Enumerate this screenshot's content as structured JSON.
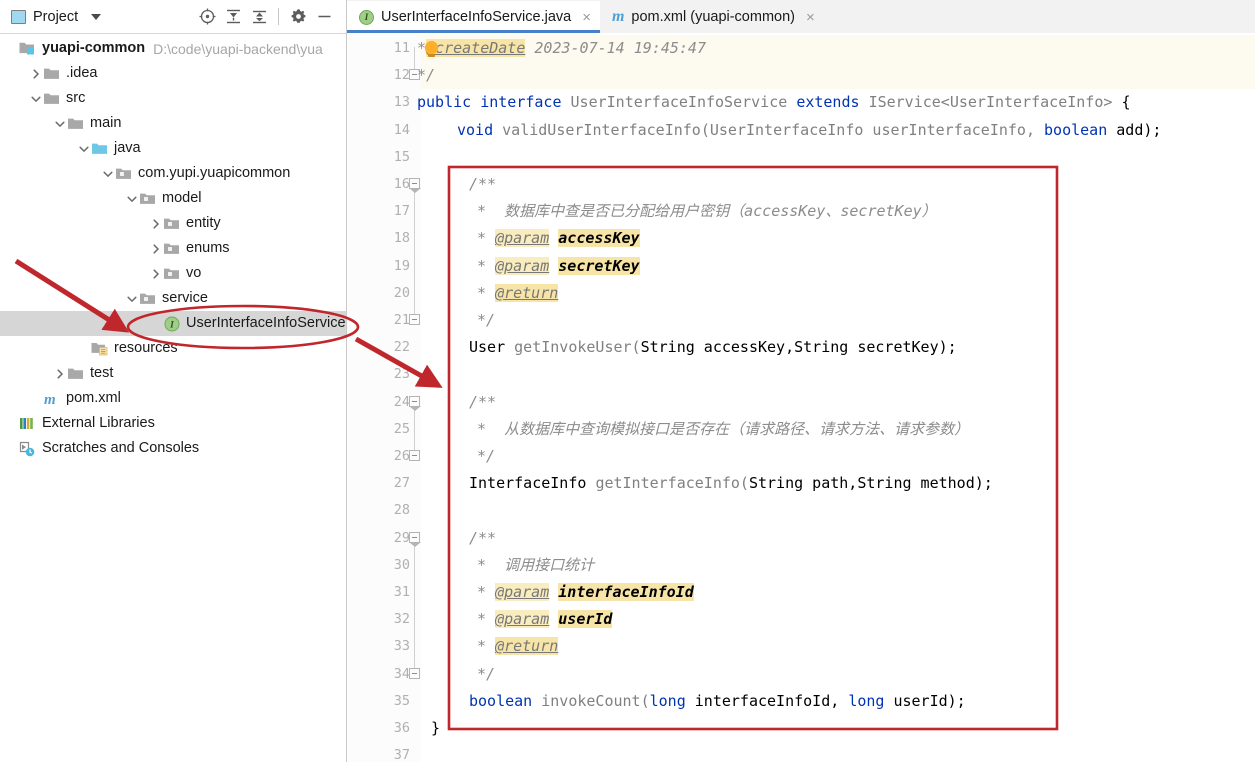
{
  "project_panel": {
    "title": "Project",
    "toolbar_icons": [
      "locate-icon",
      "collapse-all-icon",
      "expand-all-icon",
      "settings-gear-icon",
      "minimize-icon"
    ],
    "tree": [
      {
        "id": "yuapi-common",
        "label": "yuapi-common",
        "path": "D:\\code\\yuapi-backend\\yua",
        "indent": 0,
        "twisty": "none",
        "icon": "module-icon",
        "bold": true,
        "selected": false
      },
      {
        "id": "idea",
        "label": ".idea",
        "indent": 1,
        "twisty": "right",
        "icon": "folder-icon",
        "bold": false,
        "selected": false
      },
      {
        "id": "src",
        "label": "src",
        "indent": 1,
        "twisty": "down",
        "icon": "folder-icon",
        "bold": false,
        "selected": false
      },
      {
        "id": "main",
        "label": "main",
        "indent": 2,
        "twisty": "down",
        "icon": "folder-icon",
        "bold": false,
        "selected": false
      },
      {
        "id": "java",
        "label": "java",
        "indent": 3,
        "twisty": "down",
        "icon": "source-root-folder-icon",
        "bold": false,
        "selected": false
      },
      {
        "id": "com-yupi-yuapicommon",
        "label": "com.yupi.yuapicommon",
        "indent": 4,
        "twisty": "down",
        "icon": "package-icon",
        "bold": false,
        "selected": false
      },
      {
        "id": "model",
        "label": "model",
        "indent": 5,
        "twisty": "down",
        "icon": "package-icon",
        "bold": false,
        "selected": false
      },
      {
        "id": "entity",
        "label": "entity",
        "indent": 6,
        "twisty": "right",
        "icon": "package-icon",
        "bold": false,
        "selected": false
      },
      {
        "id": "enums",
        "label": "enums",
        "indent": 6,
        "twisty": "right",
        "icon": "package-icon",
        "bold": false,
        "selected": false
      },
      {
        "id": "vo",
        "label": "vo",
        "indent": 6,
        "twisty": "right",
        "icon": "package-icon",
        "bold": false,
        "selected": false
      },
      {
        "id": "service",
        "label": "service",
        "indent": 5,
        "twisty": "down",
        "icon": "package-icon",
        "bold": false,
        "selected": false
      },
      {
        "id": "userinterfaceinfoservice",
        "label": "UserInterfaceInfoService",
        "indent": 6,
        "twisty": "none",
        "icon": "java-interface-icon",
        "bold": false,
        "selected": true
      },
      {
        "id": "resources",
        "label": "resources",
        "indent": 3,
        "twisty": "none",
        "icon": "resources-folder-icon",
        "bold": false,
        "selected": false
      },
      {
        "id": "test",
        "label": "test",
        "indent": 2,
        "twisty": "right",
        "icon": "folder-icon",
        "bold": false,
        "selected": false
      },
      {
        "id": "pom-xml",
        "label": "pom.xml",
        "indent": 1,
        "twisty": "none",
        "icon": "maven-icon",
        "bold": false,
        "selected": false
      },
      {
        "id": "external-libraries",
        "label": "External Libraries",
        "indent": 0,
        "twisty": "none",
        "icon": "libraries-icon",
        "bold": false,
        "selected": false
      },
      {
        "id": "scratches-and-consoles",
        "label": "Scratches and Consoles",
        "indent": 0,
        "twisty": "none",
        "icon": "scratches-icon",
        "bold": false,
        "selected": false
      }
    ]
  },
  "editor": {
    "tabs": [
      {
        "id": "tab-userinterfaceinfoservice",
        "label": "UserInterfaceInfoService.java",
        "icon": "java-interface-icon",
        "active": true,
        "close": "×"
      },
      {
        "id": "tab-pom",
        "label": "pom.xml (yuapi-common)",
        "icon": "maven-icon",
        "active": false,
        "close": "×"
      }
    ],
    "first_line_number": 11,
    "last_line_number": 37,
    "lines": [
      {
        "n": 11,
        "highlight": true,
        "fold": "none"
      },
      {
        "n": 12,
        "highlight": true,
        "fold": "end"
      },
      {
        "n": 13,
        "highlight": false,
        "fold": "none"
      },
      {
        "n": 14,
        "highlight": false,
        "fold": "none"
      },
      {
        "n": 15,
        "highlight": false,
        "fold": "none"
      },
      {
        "n": 16,
        "highlight": false,
        "fold": "start"
      },
      {
        "n": 17,
        "highlight": false,
        "fold": "none"
      },
      {
        "n": 18,
        "highlight": false,
        "fold": "none"
      },
      {
        "n": 19,
        "highlight": false,
        "fold": "none"
      },
      {
        "n": 20,
        "highlight": false,
        "fold": "none"
      },
      {
        "n": 21,
        "highlight": false,
        "fold": "end"
      },
      {
        "n": 22,
        "highlight": false,
        "fold": "none"
      },
      {
        "n": 23,
        "highlight": false,
        "fold": "none"
      },
      {
        "n": 24,
        "highlight": false,
        "fold": "start"
      },
      {
        "n": 25,
        "highlight": false,
        "fold": "none"
      },
      {
        "n": 26,
        "highlight": false,
        "fold": "end"
      },
      {
        "n": 27,
        "highlight": false,
        "fold": "none"
      },
      {
        "n": 28,
        "highlight": false,
        "fold": "none"
      },
      {
        "n": 29,
        "highlight": false,
        "fold": "start"
      },
      {
        "n": 30,
        "highlight": false,
        "fold": "none"
      },
      {
        "n": 31,
        "highlight": false,
        "fold": "none"
      },
      {
        "n": 32,
        "highlight": false,
        "fold": "none"
      },
      {
        "n": 33,
        "highlight": false,
        "fold": "none"
      },
      {
        "n": 34,
        "highlight": false,
        "fold": "end"
      },
      {
        "n": 35,
        "highlight": false,
        "fold": "none"
      },
      {
        "n": 36,
        "highlight": false,
        "fold": "none"
      },
      {
        "n": 37,
        "highlight": false,
        "fold": "none"
      }
    ],
    "code": {
      "l11_star": "*",
      "l11_tag": "@createDate",
      "l11_rest": " 2023-07-14 19:45:47",
      "l12": "*/",
      "l13_a": "public",
      "l13_b": "interface",
      "l13_c": "UserInterfaceInfoService",
      "l13_d": "extends",
      "l13_e": "IService<UserInterfaceInfo>",
      "l13_f": "{",
      "l14_a": "void",
      "l14_b": "validUserInterfaceInfo(UserInterfaceInfo userInterfaceInfo,",
      "l14_c": "boolean",
      "l14_d": "add);",
      "l16": "/**",
      "l17_star": "*",
      "l17_text": "数据库中查是否已分配给用户密钥（accessKey、secretKey）",
      "l18_star": "*",
      "l18_tag": "@param",
      "l18_val": "accessKey",
      "l19_star": "*",
      "l19_tag": "@param",
      "l19_val": "secretKey",
      "l20_star": "*",
      "l20_tag": "@return",
      "l21": "*/",
      "l22_a": "User",
      "l22_b": "getInvokeUser(",
      "l22_c": "String accessKey,String secretKey);",
      "l24": "/**",
      "l25_star": "*",
      "l25_text": "从数据库中查询模拟接口是否存在（请求路径、请求方法、请求参数）",
      "l26": "*/",
      "l27_a": "InterfaceInfo",
      "l27_b": "getInterfaceInfo(",
      "l27_c": "String path,String method);",
      "l29": "/**",
      "l30_star": "*",
      "l30_text": "调用接口统计",
      "l31_star": "*",
      "l31_tag": "@param",
      "l31_val": "interfaceInfoId",
      "l32_star": "*",
      "l32_tag": "@param",
      "l32_val": "userId",
      "l33_star": "*",
      "l33_tag": "@return",
      "l34": "*/",
      "l35_a": "boolean",
      "l35_b": "invokeCount(",
      "l35_c": "long",
      "l35_d": "interfaceInfoId,",
      "l35_e": "long",
      "l35_f": "userId);",
      "l36": "}"
    }
  },
  "annotations": {
    "highlight_color": "#c0272d",
    "shapes": [
      {
        "id": "ellipse-userinterfaceinfoservice",
        "type": "ellipse"
      },
      {
        "id": "arrow-to-tree-item",
        "type": "arrow"
      },
      {
        "id": "arrow-to-code-block",
        "type": "arrow"
      },
      {
        "id": "rect-code-block",
        "type": "rectangle"
      }
    ]
  }
}
